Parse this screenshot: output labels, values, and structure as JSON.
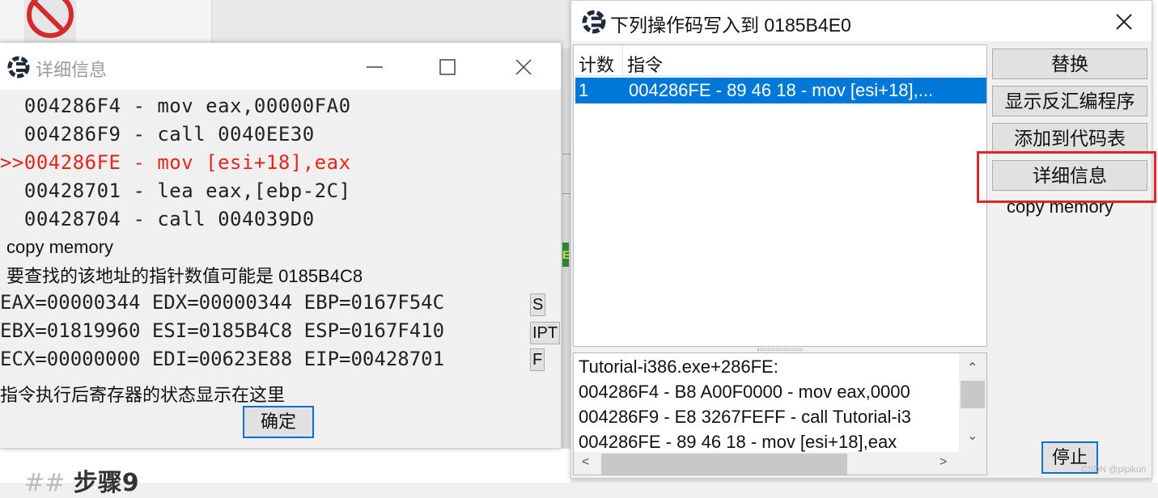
{
  "detail_window": {
    "title": "详细信息",
    "asm_lines": [
      "  004286F4 - mov eax,00000FA0",
      "  004286F9 - call 0040EE30",
      ">>004286FE - mov [esi+18],eax",
      "  00428701 - lea eax,[ebp-2C]",
      "  00428704 - call 004039D0"
    ],
    "copy_memory": "copy memory",
    "pointer_hint": "要查找的该地址的指针数值可能是 0185B4C8",
    "registers": [
      "EAX=00000344 EDX=00000344 EBP=0167F54C",
      "EBX=01819960 ESI=0185B4C8 ESP=0167F410",
      "ECX=00000000 EDI=00623E88 EIP=00428701"
    ],
    "reg_buttons": [
      "S",
      "IPT",
      "F"
    ],
    "status_text": "指令执行后寄存器的状态显示在这里",
    "ok_label": "确定"
  },
  "write_window": {
    "title": "下列操作码写入到 0185B4E0",
    "columns": [
      "计数",
      "指令"
    ],
    "rows": [
      {
        "count": "1",
        "instruction": "004286FE - 89 46 18  - mov [esi+18],..."
      }
    ],
    "code_lines": [
      "Tutorial-i386.exe+286FE:",
      "004286F4 - B8 A00F0000 - mov eax,0000",
      "004286F9 - E8 3267FEFF - call Tutorial-i3",
      "004286FE - 89 46 18  - mov [esi+18],eax"
    ],
    "buttons": {
      "replace": "替换",
      "show_disassembler": "显示反汇编程序",
      "add_to_codelist": "添加到代码表",
      "more_info": "详细信息",
      "copy_memory": "copy memory",
      "stop": "停止"
    }
  },
  "background": {
    "heading_hash": "##",
    "heading_text": "步骤9"
  },
  "watermark": "CSDN @pipikun",
  "colors": {
    "selection": "#0078d7",
    "current_line": "#e8231a",
    "highlight_box": "#e0242a",
    "default_button_border": "#0a6fd1"
  }
}
